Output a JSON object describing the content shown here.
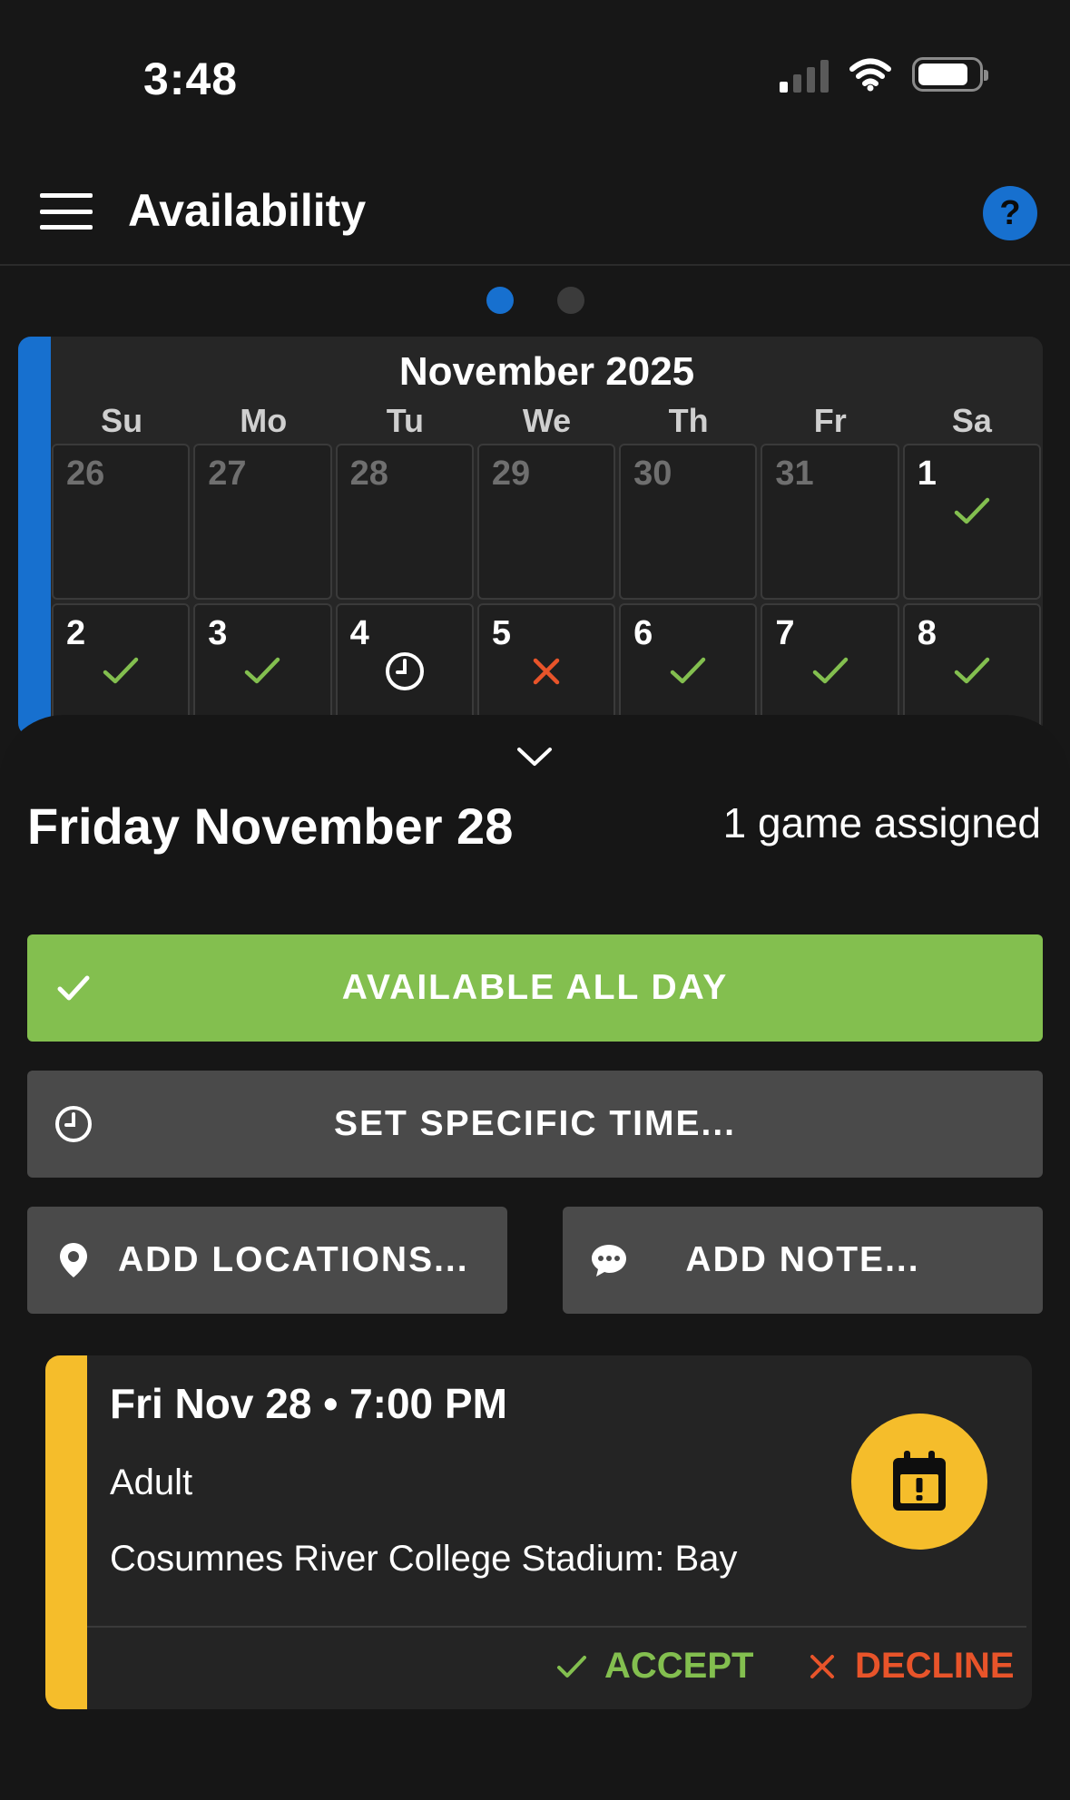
{
  "status_bar": {
    "time": "3:48"
  },
  "header": {
    "title": "Availability",
    "help_label": "?"
  },
  "pager": {
    "pages": 2,
    "active": 0
  },
  "calendar": {
    "month_title": "November 2025",
    "weekdays": [
      "Su",
      "Mo",
      "Tu",
      "We",
      "Th",
      "Fr",
      "Sa"
    ],
    "weeks": [
      [
        {
          "day": "26",
          "other": true,
          "status": ""
        },
        {
          "day": "27",
          "other": true,
          "status": ""
        },
        {
          "day": "28",
          "other": true,
          "status": ""
        },
        {
          "day": "29",
          "other": true,
          "status": ""
        },
        {
          "day": "30",
          "other": true,
          "status": ""
        },
        {
          "day": "31",
          "other": true,
          "status": ""
        },
        {
          "day": "1",
          "other": false,
          "status": "available"
        }
      ],
      [
        {
          "day": "2",
          "other": false,
          "status": "available"
        },
        {
          "day": "3",
          "other": false,
          "status": "available"
        },
        {
          "day": "4",
          "other": false,
          "status": "time"
        },
        {
          "day": "5",
          "other": false,
          "status": "unavailable"
        },
        {
          "day": "6",
          "other": false,
          "status": "available"
        },
        {
          "day": "7",
          "other": false,
          "status": "available"
        },
        {
          "day": "8",
          "other": false,
          "status": "available"
        }
      ]
    ],
    "status_icons": {
      "available": "check-icon",
      "time": "clock-icon",
      "unavailable": "x-icon"
    }
  },
  "sheet": {
    "day_title": "Friday November 28",
    "game_count": "1 game assigned",
    "available_all_day": "AVAILABLE ALL DAY",
    "set_specific_time": "SET SPECIFIC TIME...",
    "add_locations": "ADD LOCATIONS...",
    "add_note": "ADD NOTE..."
  },
  "game": {
    "datetime": "Fri Nov 28 • 7:00 PM",
    "level": "Adult",
    "venue": "Cosumnes River College Stadium: Bay",
    "accept_label": "ACCEPT",
    "decline_label": "DECLINE"
  },
  "colors": {
    "accent_blue": "#1770cf",
    "available_green": "#83bf4f",
    "decline_red": "#e8542a",
    "game_yellow": "#f5bd2b",
    "button_gray": "#4a4a4a"
  }
}
